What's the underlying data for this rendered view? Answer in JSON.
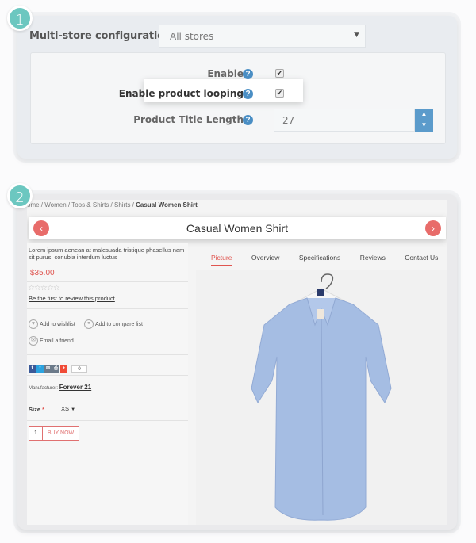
{
  "steps": [
    "1",
    "2"
  ],
  "config": {
    "multistore_label": "Multi-store configuration for",
    "store_select_value": "All stores",
    "fields": [
      {
        "label": "Enable",
        "checked": true
      },
      {
        "label": "Enable product looping",
        "checked": true
      },
      {
        "label": "Product Title Length",
        "value": "27"
      }
    ]
  },
  "product": {
    "breadcrumb": [
      "ome",
      "Women",
      "Tops & Shirts",
      "Shirts"
    ],
    "breadcrumb_current": "Casual Women Shirt",
    "title": "Casual Women Shirt",
    "description": "Lorem ipsum aenean at malesuada tristique phasellus nam sit purus, conubia interdum luctus",
    "price": "$35.00",
    "review_link": "Be the first to review this product",
    "actions": {
      "wishlist": "Add to wishlist",
      "compare": "Add to compare list",
      "email": "Email a friend"
    },
    "share_count": "0",
    "manufacturer_label": "Manufacturer:",
    "manufacturer": "Forever 21",
    "size_label": "Size",
    "size_value": "XS",
    "quantity": "1",
    "buy_label": "BUY NOW",
    "tabs": [
      "Picture",
      "Overview",
      "Specifications",
      "Reviews",
      "Contact Us"
    ]
  },
  "colors": {
    "accent": "#e05550",
    "badge": "#6cc7c0",
    "help": "#4a8ec4",
    "shirt": "#a5bde3"
  }
}
